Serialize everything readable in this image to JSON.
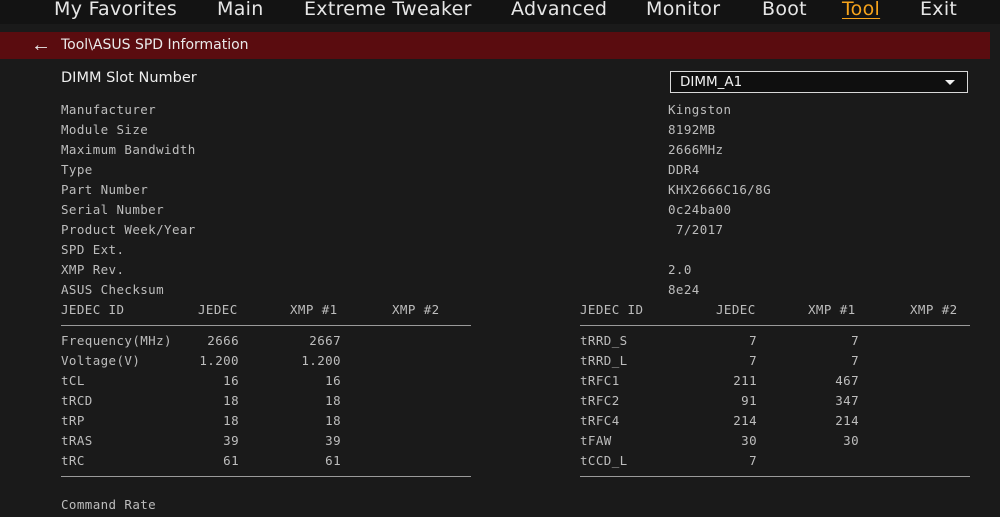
{
  "nav": {
    "tabs": [
      "My Favorites",
      "Main",
      "Extreme Tweaker",
      "Advanced",
      "Monitor",
      "Boot",
      "Tool",
      "Exit"
    ],
    "active": "Tool"
  },
  "breadcrumb": {
    "back_icon": "arrow-left-icon",
    "path": "Tool\\ASUS SPD Information"
  },
  "dimm": {
    "label": "DIMM Slot Number",
    "selected": "DIMM_A1"
  },
  "info": [
    {
      "label": "Manufacturer",
      "value": "Kingston"
    },
    {
      "label": "Module Size",
      "value": "8192MB"
    },
    {
      "label": "Maximum Bandwidth",
      "value": "2666MHz"
    },
    {
      "label": "Type",
      "value": "DDR4"
    },
    {
      "label": "Part Number",
      "value": "KHX2666C16/8G"
    },
    {
      "label": "Serial Number",
      "value": "0c24ba00"
    },
    {
      "label": "Product Week/Year",
      "value": " 7/2017"
    },
    {
      "label": "SPD Ext.",
      "value": ""
    },
    {
      "label": "XMP Rev.",
      "value": "2.0"
    },
    {
      "label": "ASUS Checksum",
      "value": "8e24"
    }
  ],
  "table_left": {
    "headers": [
      "JEDEC ID",
      "JEDEC",
      "XMP #1",
      "XMP #2"
    ],
    "rows": [
      [
        "Frequency(MHz)",
        "2666",
        "2667",
        ""
      ],
      [
        "Voltage(V)",
        "1.200",
        "1.200",
        ""
      ],
      [
        "tCL",
        "16",
        "16",
        ""
      ],
      [
        "tRCD",
        "18",
        "18",
        ""
      ],
      [
        "tRP",
        "18",
        "18",
        ""
      ],
      [
        "tRAS",
        "39",
        "39",
        ""
      ],
      [
        "tRC",
        "61",
        "61",
        ""
      ]
    ]
  },
  "table_right": {
    "headers": [
      "JEDEC ID",
      "JEDEC",
      "XMP #1",
      "XMP #2"
    ],
    "rows": [
      [
        "tRRD_S",
        "7",
        "7",
        ""
      ],
      [
        "tRRD_L",
        "7",
        "7",
        ""
      ],
      [
        "tRFC1",
        "211",
        "467",
        ""
      ],
      [
        "tRFC2",
        "91",
        "347",
        ""
      ],
      [
        "tRFC4",
        "214",
        "214",
        ""
      ],
      [
        "tFAW",
        "30",
        "30",
        ""
      ],
      [
        "tCCD_L",
        "7",
        "",
        ""
      ]
    ]
  },
  "footer": {
    "command_rate_label": "Command Rate"
  },
  "colors": {
    "accent": "#f6a31b",
    "crumb_bar": "#5a0c0f",
    "background": "#1a1a1a"
  }
}
